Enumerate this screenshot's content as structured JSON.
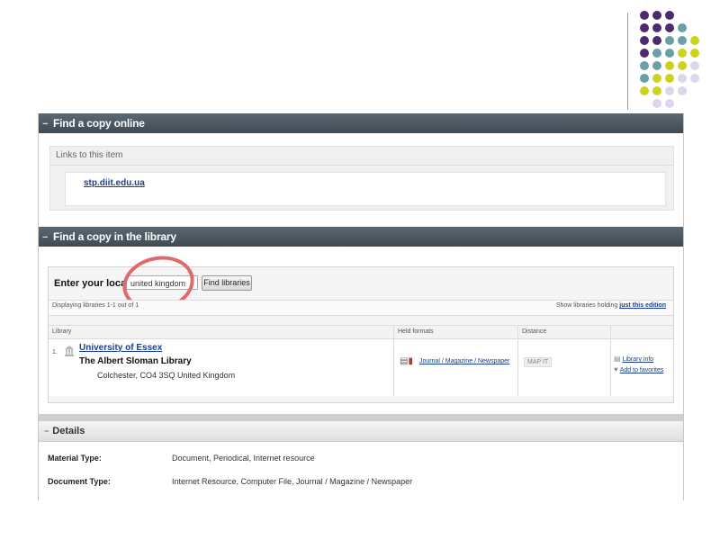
{
  "decoration": {
    "dot_colors": {
      "purple": "#4b2a6e",
      "teal": "#6a9fa6",
      "yellow": "#cdd21e",
      "lavender": "#dcd6ea"
    }
  },
  "online": {
    "header": "Find a copy online",
    "links_label": "Links to this item",
    "link": "stp.diit.edu.ua"
  },
  "library": {
    "header": "Find a copy in the library",
    "location_label": "Enter your location:",
    "location_value": "united kingdom",
    "find_button": "Find libraries",
    "displaying": "Displaying libraries 1-1 out of 1",
    "show_prefix": "Show libraries holding",
    "show_link": "just this edition",
    "columns": {
      "library": "Library",
      "held_formats": "Held formats",
      "distance": "Distance"
    },
    "row": {
      "number": "1.",
      "name": "University of Essex",
      "branch": "The Albert Sloman Library",
      "address": "Colchester, CO4 3SQ United Kingdom",
      "format": "Journal / Magazine / Newspaper",
      "map_button": "MAP IT",
      "library_info": "Library info",
      "add_favorites": "Add to favorites"
    }
  },
  "details": {
    "header": "Details",
    "rows": [
      {
        "label": "Material Type:",
        "value": "Document, Periodical, Internet resource"
      },
      {
        "label": "Document Type:",
        "value": "Internet Resource, Computer File, Journal / Magazine / Newspaper"
      }
    ]
  },
  "colors": {
    "header_dark": "#4a5660",
    "link_blue": "#1a3f91",
    "annotation_red": "#e06a6a"
  }
}
